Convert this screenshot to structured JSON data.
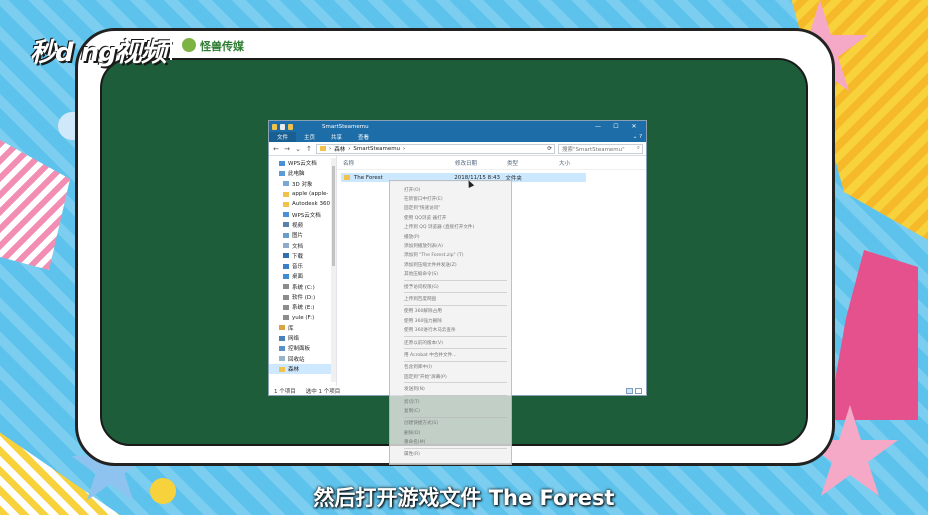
{
  "branding": {
    "logo_text": "秒d ng视频",
    "partner_text": "怪兽传媒"
  },
  "window": {
    "title": "SmartSteamemu",
    "tabs": [
      "文件",
      "主页",
      "共享",
      "查看"
    ],
    "help_icon": "help-icon",
    "address": {
      "path": [
        "森林",
        "SmartSteamemu"
      ]
    },
    "search_placeholder": "搜索\"SmartSteamemu\"",
    "nav_items": [
      {
        "label": "WPS云文档",
        "icon": "cloud-icon",
        "top": true
      },
      {
        "label": "此电脑",
        "icon": "computer-icon",
        "top": true
      },
      {
        "label": "3D 对象",
        "icon": "cube-icon"
      },
      {
        "label": "apple (apple-",
        "icon": "folder-icon"
      },
      {
        "label": "Autodesk 360",
        "icon": "folder-icon"
      },
      {
        "label": "WPS云文档",
        "icon": "cloud-icon"
      },
      {
        "label": "视频",
        "icon": "video-icon"
      },
      {
        "label": "图片",
        "icon": "picture-icon"
      },
      {
        "label": "文档",
        "icon": "document-icon"
      },
      {
        "label": "下载",
        "icon": "download-icon"
      },
      {
        "label": "音乐",
        "icon": "music-icon"
      },
      {
        "label": "桌面",
        "icon": "desktop-icon"
      },
      {
        "label": "系统 (C:)",
        "icon": "drive-icon"
      },
      {
        "label": "软件 (D:)",
        "icon": "drive-icon"
      },
      {
        "label": "系统 (E:)",
        "icon": "drive-icon"
      },
      {
        "label": "yule (F:)",
        "icon": "drive-icon"
      },
      {
        "label": "库",
        "icon": "library-icon",
        "top": true
      },
      {
        "label": "网络",
        "icon": "network-icon",
        "top": true
      },
      {
        "label": "控制面板",
        "icon": "control-panel-icon",
        "top": true
      },
      {
        "label": "回收站",
        "icon": "recycle-bin-icon",
        "top": true
      },
      {
        "label": "森林",
        "icon": "folder-icon",
        "top": true,
        "selected": true
      }
    ],
    "columns": [
      "名称",
      "修改日期",
      "类型",
      "大小"
    ],
    "rows": [
      {
        "name": "The Forest",
        "modified": "2018/11/15 8:43",
        "type": "文件夹",
        "size": ""
      }
    ],
    "status": {
      "count": "1 个项目",
      "selected": "选中 1 个项目"
    }
  },
  "context_menu": {
    "items": [
      "打开(O)",
      "在新窗口中打开(E)",
      "固定到\"快速访问\"",
      "使用 QQ浏览 器打开",
      "上传到 QQ 浏览器 (直接打开文件)",
      "播放(P)",
      "添加到播放列表(A)",
      "添加到 \"The Forest.zip\" (T)",
      "添加到压缩文件并发送(Z)",
      "其他压缩命令(S)",
      "---",
      "授予访问权限(G)",
      "---",
      "上传到百度网盘",
      "---",
      "使用 360解除占用",
      "使用 360强力删除",
      "使用 360进行木马云查杀",
      "---",
      "还原以前的版本(V)",
      "---",
      "用 Acrobat 中合并文件...",
      "---",
      "包含到库中(I)",
      "固定到\"开始\"屏幕(P)",
      "---",
      "发送到(N)",
      "---",
      "剪切(T)",
      "复制(C)",
      "---",
      "创建快捷方式(S)",
      "删除(D)",
      "重命名(M)",
      "---",
      "属性(R)"
    ]
  },
  "subtitle": "然后打开游戏文件 The Forest",
  "colors": {
    "titlebar": "#1d6ea8",
    "board": "#1d5d3a",
    "selection": "#cce8ff"
  }
}
